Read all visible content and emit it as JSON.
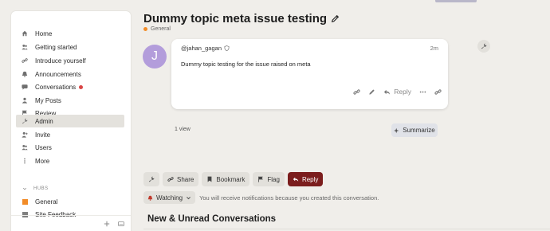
{
  "sidebar": {
    "items": [
      {
        "label": "Home",
        "icon": "home-icon"
      },
      {
        "label": "Getting started",
        "icon": "users-icon"
      },
      {
        "label": "Introduce yourself",
        "icon": "link-icon"
      },
      {
        "label": "Announcements",
        "icon": "bell-icon"
      },
      {
        "label": "Conversations",
        "icon": "comments-icon",
        "badge": true
      },
      {
        "label": "My Posts",
        "icon": "user-icon"
      },
      {
        "label": "Review",
        "icon": "flag-icon"
      },
      {
        "label": "Admin",
        "icon": "wrench-icon",
        "active": true
      },
      {
        "label": "Invite",
        "icon": "user-plus-icon"
      },
      {
        "label": "Users",
        "icon": "users-icon"
      },
      {
        "label": "More",
        "icon": "ellipsis-icon"
      }
    ],
    "hubs_heading": "HUBS",
    "hubs": [
      {
        "label": "General",
        "color": "#f28c28"
      },
      {
        "label": "Site Feedback",
        "color": "#808080"
      }
    ]
  },
  "topic": {
    "title": "Dummy topic meta issue testing",
    "category": "General",
    "category_color": "#f28c28"
  },
  "post": {
    "avatar_letter": "J",
    "avatar_color": "#b39ddb",
    "username": "@jahan_gagan",
    "time": "2m",
    "body": "Dummy topic testing for the issue raised on meta",
    "reply_label": "Reply"
  },
  "topic_map": {
    "views": "1 view",
    "summarize_label": "Summarize"
  },
  "footer": {
    "share_label": "Share",
    "bookmark_label": "Bookmark",
    "flag_label": "Flag",
    "reply_label": "Reply",
    "watching_label": "Watching",
    "notification_text": "You will receive notifications because you created this conversation."
  },
  "suggested": {
    "heading": "New & Unread Conversations"
  }
}
